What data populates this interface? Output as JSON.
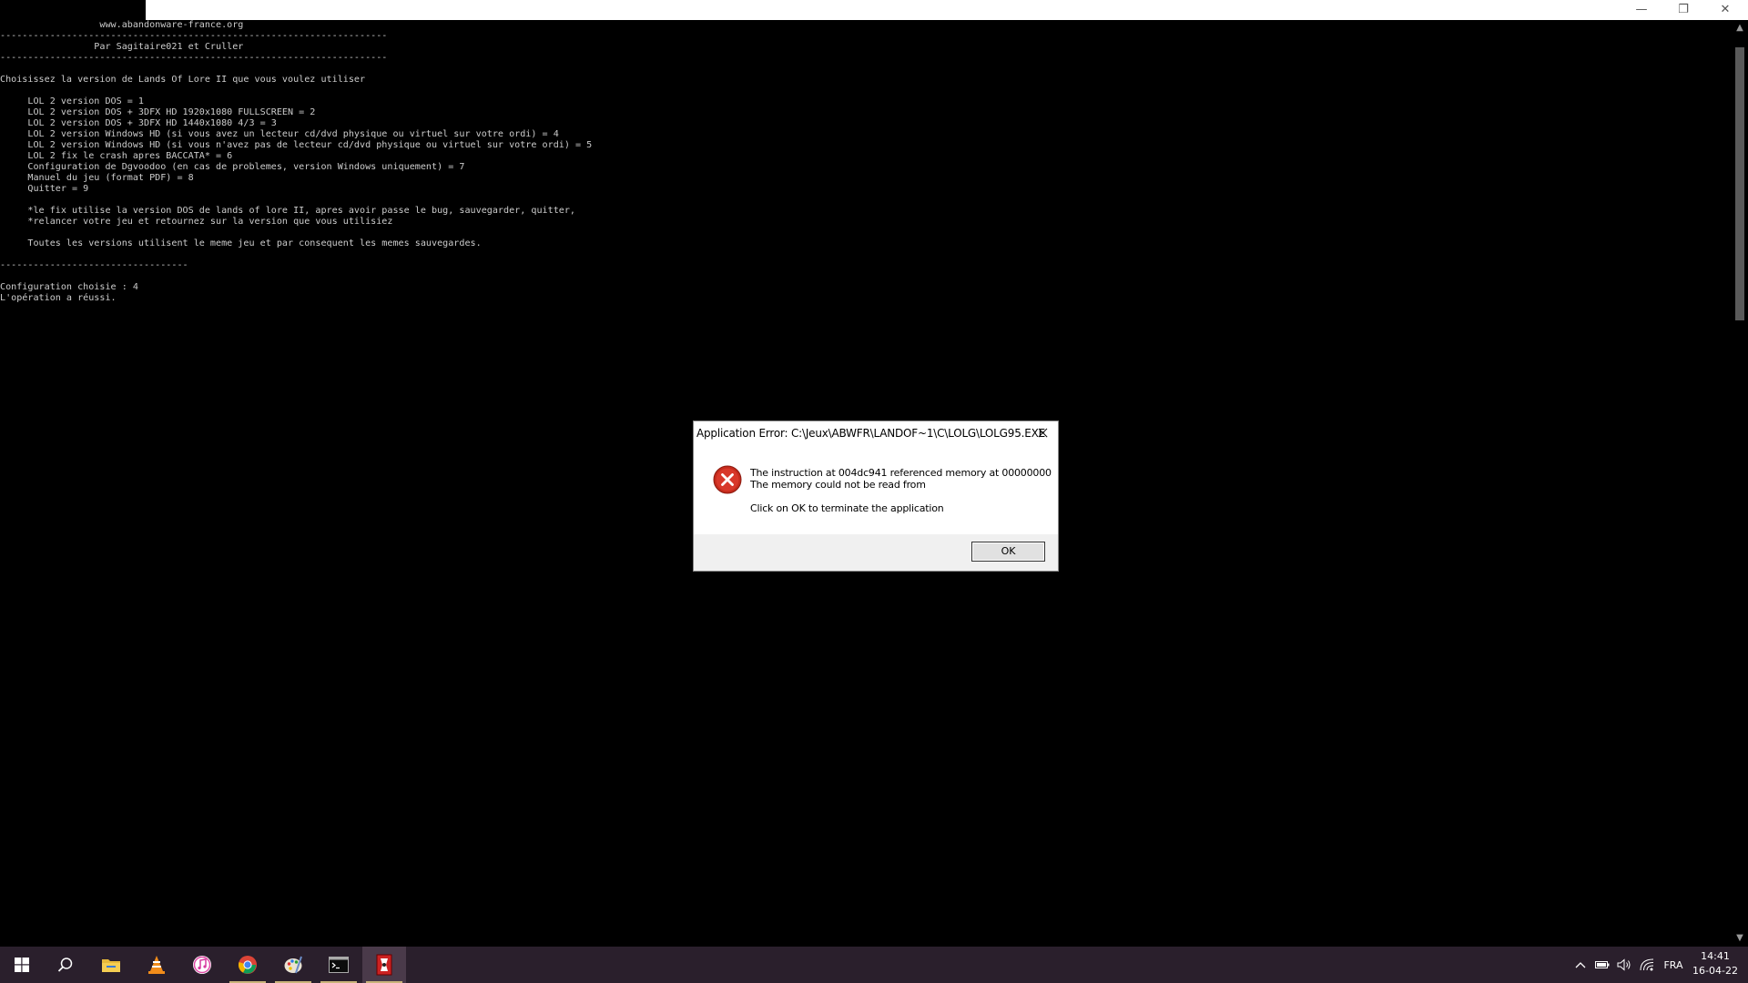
{
  "window": {
    "minimize_glyph": "—",
    "maximize_glyph": "❐",
    "close_glyph": "✕"
  },
  "console": {
    "lines": [
      "                  www.abandonware-france.org",
      "----------------------------------------------------------------------",
      "                 Par Sagitaire021 et Cruller",
      "----------------------------------------------------------------------",
      "",
      "Choisissez la version de Lands Of Lore II que vous voulez utiliser",
      "",
      "     LOL 2 version DOS = 1",
      "     LOL 2 version DOS + 3DFX HD 1920x1080 FULLSCREEN = 2",
      "     LOL 2 version DOS + 3DFX HD 1440x1080 4/3 = 3",
      "     LOL 2 version Windows HD (si vous avez un lecteur cd/dvd physique ou virtuel sur votre ordi) = 4",
      "     LOL 2 version Windows HD (si vous n'avez pas de lecteur cd/dvd physique ou virtuel sur votre ordi) = 5",
      "     LOL 2 fix le crash apres BACCATA* = 6",
      "     Configuration de Dgvoodoo (en cas de problemes, version Windows uniquement) = 7",
      "     Manuel du jeu (format PDF) = 8",
      "     Quitter = 9",
      "",
      "     *le fix utilise la version DOS de lands of lore II, apres avoir passe le bug, sauvegarder, quitter,",
      "     *relancer votre jeu et retournez sur la version que vous utilisiez",
      "",
      "     Toutes les versions utilisent le meme jeu et par consequent les memes sauvegardes.",
      "",
      "----------------------------------",
      "",
      "Configuration choisie : 4",
      "L'opération a réussi."
    ]
  },
  "dialog": {
    "title": "Application Error: C:\\Jeux\\ABWFR\\LANDOF~1\\C\\LOLG\\LOLG95.EXE",
    "message_line1": "The instruction at 004dc941 referenced memory at 00000000",
    "message_line2": "The memory could not be read from",
    "message_line3": "Click on OK to terminate the application",
    "ok_label": "OK",
    "icon": "error-icon"
  },
  "taskbar": {
    "apps": [
      {
        "name": "start-button",
        "icon": "windows-icon"
      },
      {
        "name": "search-button",
        "icon": "search-icon"
      },
      {
        "name": "file-explorer",
        "icon": "folder-icon"
      },
      {
        "name": "vlc",
        "icon": "vlc-icon"
      },
      {
        "name": "itunes",
        "icon": "music-icon"
      },
      {
        "name": "chrome",
        "icon": "chrome-icon"
      },
      {
        "name": "paint",
        "icon": "paint-icon"
      },
      {
        "name": "command-prompt",
        "icon": "terminal-icon"
      },
      {
        "name": "lands-of-lore",
        "icon": "game-icon"
      }
    ],
    "tray": {
      "language": "FRA",
      "time": "14:41",
      "date": "16-04-22"
    }
  }
}
